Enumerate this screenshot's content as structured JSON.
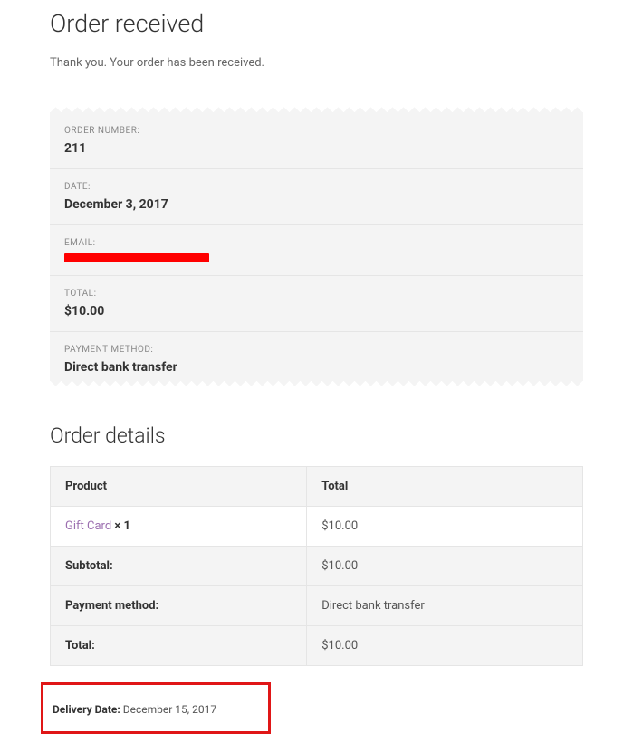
{
  "header": {
    "title": "Order received",
    "thank_you": "Thank you. Your order has been received."
  },
  "overview": {
    "order_number": {
      "label": "ORDER NUMBER:",
      "value": "211"
    },
    "date": {
      "label": "DATE:",
      "value": "December 3, 2017"
    },
    "email": {
      "label": "EMAIL:"
    },
    "total": {
      "label": "TOTAL:",
      "value": "$10.00"
    },
    "payment_method": {
      "label": "PAYMENT METHOD:",
      "value": "Direct bank transfer"
    }
  },
  "details": {
    "title": "Order details",
    "columns": {
      "product": "Product",
      "total": "Total"
    },
    "items": [
      {
        "name": "Gift Card",
        "qty": "× 1",
        "total": "$10.00"
      }
    ],
    "subtotal": {
      "label": "Subtotal:",
      "value": "$10.00"
    },
    "payment_method": {
      "label": "Payment method:",
      "value": "Direct bank transfer"
    },
    "total": {
      "label": "Total:",
      "value": "$10.00"
    }
  },
  "delivery": {
    "label": "Delivery Date:",
    "value": " December 15, 2017"
  }
}
